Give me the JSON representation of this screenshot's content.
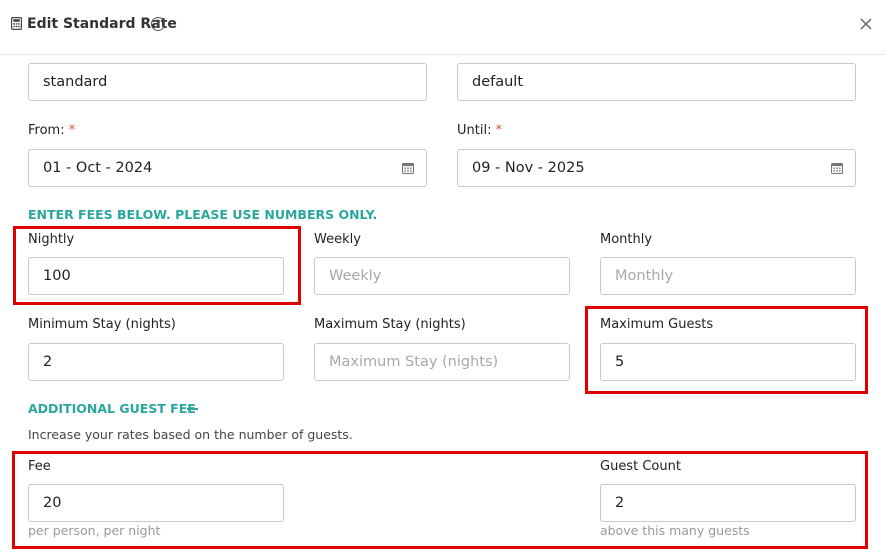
{
  "header": {
    "title": "Edit Standard Rate",
    "help_glyph": "?"
  },
  "rate": {
    "name_value": "standard",
    "type_value": "default"
  },
  "dates": {
    "from_label": "From:",
    "from_value": "01 - Oct - 2024",
    "until_label": "Until:",
    "until_value": "09 - Nov - 2025",
    "required_mark": "*"
  },
  "fees": {
    "section_title": "ENTER FEES BELOW. PLEASE USE NUMBERS ONLY.",
    "nightly_label": "Nightly",
    "nightly_value": "100",
    "weekly_label": "Weekly",
    "weekly_placeholder": "Weekly",
    "monthly_label": "Monthly",
    "monthly_placeholder": "Monthly",
    "min_stay_label": "Minimum Stay (nights)",
    "min_stay_value": "2",
    "max_stay_label": "Maximum Stay (nights)",
    "max_stay_placeholder": "Maximum Stay (nights)",
    "max_guests_label": "Maximum Guests",
    "max_guests_value": "5"
  },
  "guest_fee": {
    "section_title": "ADDITIONAL GUEST FEE",
    "help_text": "Increase your rates based on the number of guests.",
    "fee_label": "Fee",
    "fee_value": "20",
    "fee_hint": "per person, per night",
    "count_label": "Guest Count",
    "count_value": "2",
    "count_hint": "above this many guests"
  },
  "colors": {
    "accent": "#2aa6a0",
    "highlight": "#e00000",
    "required": "#d9534f"
  }
}
